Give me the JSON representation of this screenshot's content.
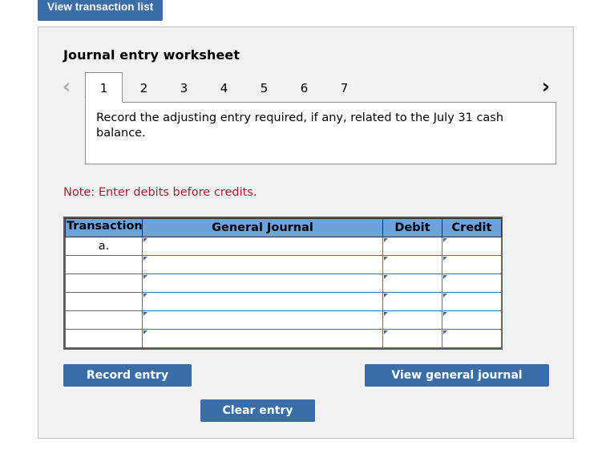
{
  "top_button": {
    "label": "View transaction list"
  },
  "panel": {
    "title": "Journal entry worksheet"
  },
  "pager": {
    "prev_icon": "chevron-left-icon",
    "next_icon": "chevron-right-icon",
    "prev_glyph": "‹",
    "next_glyph": "›",
    "tabs": [
      {
        "label": "1",
        "active": true
      },
      {
        "label": "2",
        "active": false
      },
      {
        "label": "3",
        "active": false
      },
      {
        "label": "4",
        "active": false
      },
      {
        "label": "5",
        "active": false
      },
      {
        "label": "6",
        "active": false
      },
      {
        "label": "7",
        "active": false
      }
    ]
  },
  "prompt": {
    "text": "Record the adjusting entry required, if any, related to the July 31 cash balance."
  },
  "note": {
    "text": "Note: Enter debits before credits."
  },
  "journal_table": {
    "headers": [
      "Transaction",
      "General Journal",
      "Debit",
      "Credit"
    ],
    "rows": [
      {
        "transaction": "a.",
        "general_journal": "",
        "debit": "",
        "credit": ""
      },
      {
        "transaction": "",
        "general_journal": "",
        "debit": "",
        "credit": ""
      },
      {
        "transaction": "",
        "general_journal": "",
        "debit": "",
        "credit": ""
      },
      {
        "transaction": "",
        "general_journal": "",
        "debit": "",
        "credit": ""
      },
      {
        "transaction": "",
        "general_journal": "",
        "debit": "",
        "credit": ""
      },
      {
        "transaction": "",
        "general_journal": "",
        "debit": "",
        "credit": ""
      }
    ]
  },
  "actions": {
    "record_entry": "Record entry",
    "view_general_journal": "View general journal",
    "clear_entry": "Clear entry"
  },
  "colors": {
    "button_blue": "#3a6ea8",
    "table_header_blue": "#6ea2da",
    "panel_background": "#f1f1f1",
    "note_red": "#a71f31",
    "page_background": "#ffffff"
  }
}
